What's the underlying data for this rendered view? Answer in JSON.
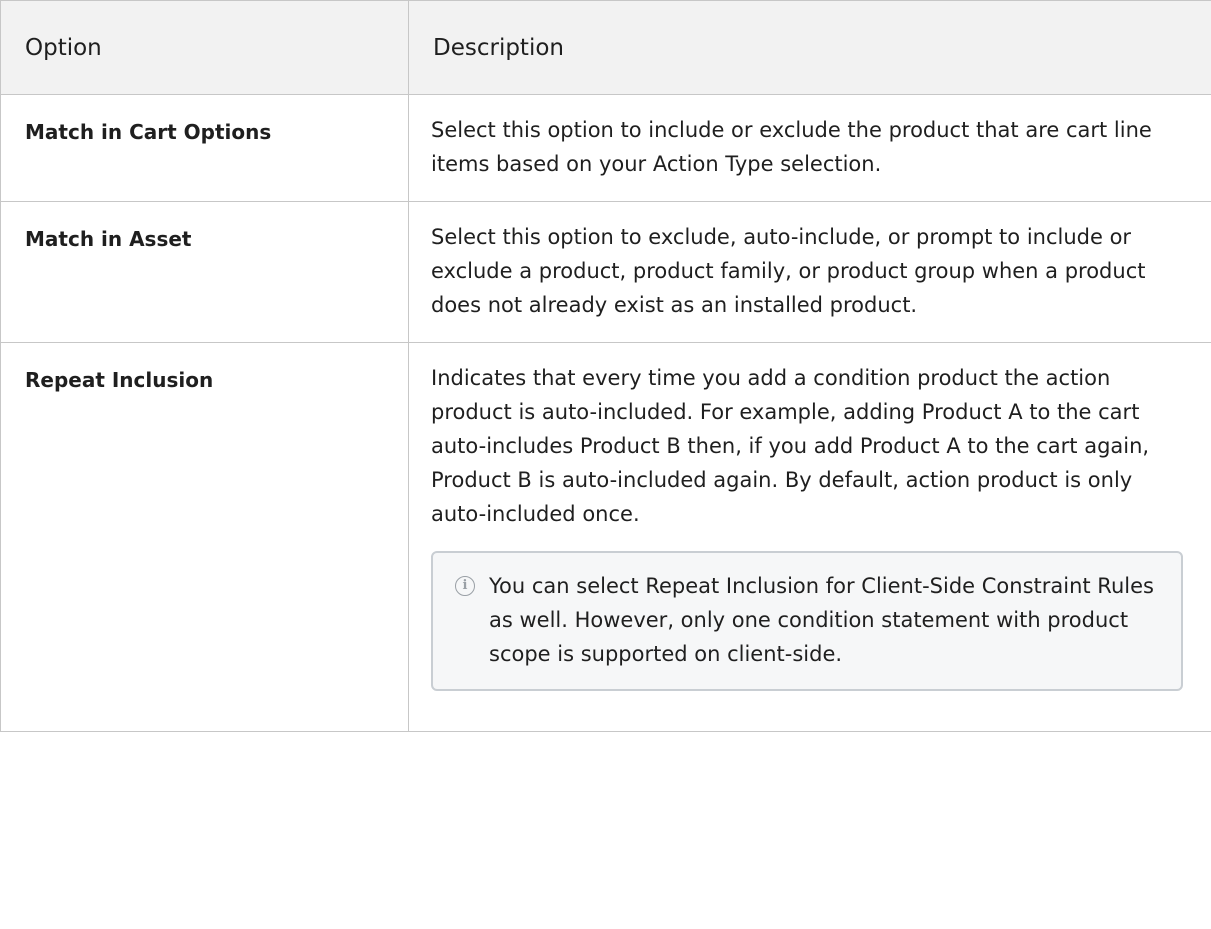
{
  "table": {
    "headers": [
      "Option",
      "Description"
    ],
    "rows": [
      {
        "option": "Match in Cart Options",
        "description": "Select this option to include or exclude the product that are cart line items based on your Action Type selection."
      },
      {
        "option": "Match in Asset",
        "description": "Select this option to exclude, auto-include, or prompt to include or exclude a product, product family, or product group when a product does not already exist as an installed product."
      },
      {
        "option": "Repeat Inclusion",
        "description": "Indicates that every time you add a condition product the action product is auto-included. For example, adding Product A to the cart auto-includes Product B then, if you add Product A to the cart again, Product B is auto-included again. By default, action product is only auto-included once.",
        "note": {
          "icon": "info-icon",
          "text": "You can select Repeat Inclusion for Client-Side Constraint Rules as well. However, only one condition statement with product scope is supported on client-side."
        }
      }
    ]
  }
}
